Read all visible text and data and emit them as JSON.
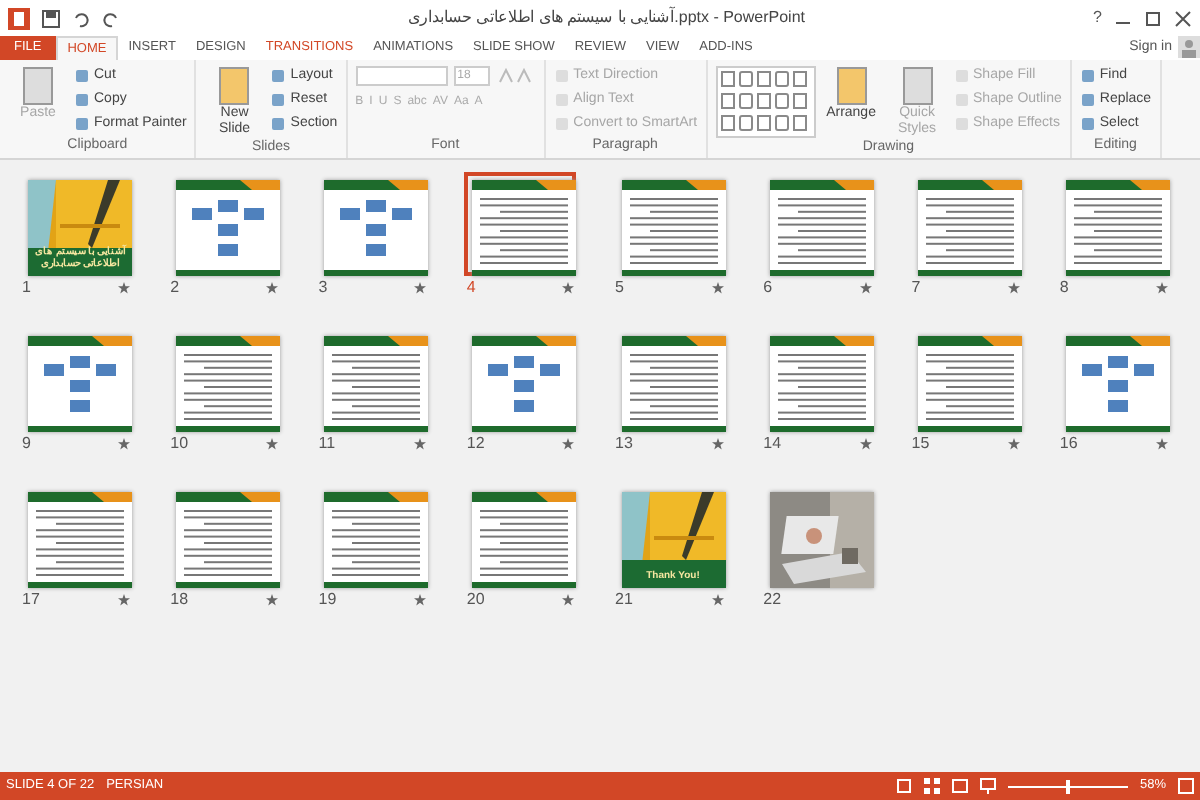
{
  "window": {
    "title": "آشنایی با سیستم های اطلاعاتی حسابداری.pptx - PowerPoint",
    "help": "?"
  },
  "tabs": [
    {
      "label": "FILE",
      "kind": "file",
      "selected": false
    },
    {
      "label": "HOME",
      "kind": "tab",
      "selected": true
    },
    {
      "label": "INSERT",
      "kind": "tab",
      "selected": false
    },
    {
      "label": "DESIGN",
      "kind": "tab",
      "selected": false
    },
    {
      "label": "TRANSITIONS",
      "kind": "accent",
      "selected": false
    },
    {
      "label": "ANIMATIONS",
      "kind": "tab",
      "selected": false
    },
    {
      "label": "SLIDE SHOW",
      "kind": "tab",
      "selected": false
    },
    {
      "label": "REVIEW",
      "kind": "tab",
      "selected": false
    },
    {
      "label": "VIEW",
      "kind": "tab",
      "selected": false
    },
    {
      "label": "ADD-INS",
      "kind": "tab",
      "selected": false
    }
  ],
  "account": {
    "label": "Sign in"
  },
  "ribbon": [
    {
      "label": "Clipboard",
      "kind": "buttons",
      "items": [
        {
          "kind": "large",
          "label": "Paste",
          "disabled": true
        },
        {
          "kind": "small",
          "label": "Cut",
          "disabled": false
        },
        {
          "kind": "small",
          "label": "Copy",
          "disabled": false
        },
        {
          "kind": "small",
          "label": "Format Painter",
          "disabled": false
        }
      ]
    },
    {
      "label": "Slides",
      "kind": "buttons",
      "items": [
        {
          "kind": "large",
          "label": "New Slide",
          "disabled": false
        },
        {
          "kind": "small",
          "label": "Layout",
          "disabled": false
        },
        {
          "kind": "small",
          "label": "Reset",
          "disabled": false
        },
        {
          "kind": "small",
          "label": "Section",
          "disabled": false
        }
      ]
    },
    {
      "label": "Font",
      "kind": "font",
      "size": "18",
      "format_buttons": [
        "B",
        "I",
        "U",
        "S",
        "abc",
        "AV",
        "Aa",
        "A"
      ]
    },
    {
      "label": "Paragraph",
      "kind": "buttons",
      "items": [
        {
          "kind": "small",
          "label": "Text Direction",
          "disabled": true
        },
        {
          "kind": "small",
          "label": "Align Text",
          "disabled": true
        },
        {
          "kind": "small",
          "label": "Convert to SmartArt",
          "disabled": true
        }
      ]
    },
    {
      "label": "Drawing",
      "kind": "buttons",
      "items": [
        {
          "kind": "gallery",
          "disabled": false
        },
        {
          "kind": "large",
          "label": "Arrange",
          "disabled": false
        },
        {
          "kind": "large",
          "label": "Quick Styles",
          "disabled": true
        },
        {
          "kind": "small",
          "label": "Shape Fill",
          "disabled": true
        },
        {
          "kind": "small",
          "label": "Shape Outline",
          "disabled": true
        },
        {
          "kind": "small",
          "label": "Shape Effects",
          "disabled": true
        }
      ]
    },
    {
      "label": "Editing",
      "kind": "buttons",
      "items": [
        {
          "kind": "small",
          "label": "Find",
          "disabled": false
        },
        {
          "kind": "small",
          "label": "Replace",
          "disabled": false
        },
        {
          "kind": "small",
          "label": "Select",
          "disabled": false
        }
      ]
    }
  ],
  "slides": [
    {
      "number": "1",
      "kind": "title",
      "title": "آشنایی با سیستم های اطلاعاتی حسابداری",
      "selected": false,
      "transition": true
    },
    {
      "number": "2",
      "kind": "diagram",
      "selected": false,
      "transition": true
    },
    {
      "number": "3",
      "kind": "diagram",
      "selected": false,
      "transition": true
    },
    {
      "number": "4",
      "kind": "text",
      "selected": true,
      "transition": true
    },
    {
      "number": "5",
      "kind": "text",
      "selected": false,
      "transition": true
    },
    {
      "number": "6",
      "kind": "text",
      "selected": false,
      "transition": true
    },
    {
      "number": "7",
      "kind": "text",
      "selected": false,
      "transition": true
    },
    {
      "number": "8",
      "kind": "text",
      "selected": false,
      "transition": true
    },
    {
      "number": "9",
      "kind": "diagram",
      "selected": false,
      "transition": true
    },
    {
      "number": "10",
      "kind": "text",
      "selected": false,
      "transition": true
    },
    {
      "number": "11",
      "kind": "text",
      "selected": false,
      "transition": true
    },
    {
      "number": "12",
      "kind": "diagram",
      "selected": false,
      "transition": true
    },
    {
      "number": "13",
      "kind": "text",
      "selected": false,
      "transition": true
    },
    {
      "number": "14",
      "kind": "text",
      "selected": false,
      "transition": true
    },
    {
      "number": "15",
      "kind": "text",
      "selected": false,
      "transition": true
    },
    {
      "number": "16",
      "kind": "diagram",
      "selected": false,
      "transition": true
    },
    {
      "number": "17",
      "kind": "text",
      "selected": false,
      "transition": true
    },
    {
      "number": "18",
      "kind": "text",
      "selected": false,
      "transition": true
    },
    {
      "number": "19",
      "kind": "text",
      "selected": false,
      "transition": true
    },
    {
      "number": "20",
      "kind": "text",
      "selected": false,
      "transition": true
    },
    {
      "number": "21",
      "kind": "title",
      "title": "Thank You!",
      "selected": false,
      "transition": true
    },
    {
      "number": "22",
      "selected": false,
      "transition": false
    }
  ],
  "status_bar": {
    "slide_indicator": "SLIDE 4 OF 22",
    "language": "PERSIAN",
    "zoom": "58%",
    "level": 0.5
  }
}
